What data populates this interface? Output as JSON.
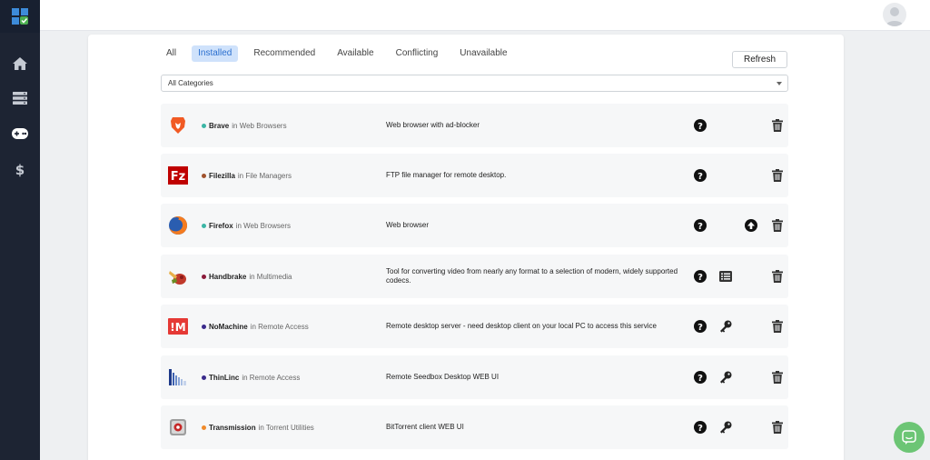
{
  "sidebar": {
    "logo_icon": "app-grid-logo",
    "nav": [
      {
        "name": "home",
        "icon": "home-icon"
      },
      {
        "name": "servers",
        "icon": "server-icon"
      },
      {
        "name": "apps",
        "icon": "gamepad-icon",
        "active": true
      },
      {
        "name": "billing",
        "icon": "dollar-icon"
      }
    ]
  },
  "header": {
    "avatar_icon": "user-avatar-icon"
  },
  "tabs": {
    "all": "All",
    "installed": "Installed",
    "recommended": "Recommended",
    "available": "Available",
    "conflicting": "Conflicting",
    "unavailable": "Unavailable",
    "active": "Installed"
  },
  "toolbar": {
    "refresh_label": "Refresh"
  },
  "filter": {
    "category_value": "All Categories"
  },
  "apps": [
    {
      "name": "Brave",
      "category": "in Web Browsers",
      "description": "Web browser with ad-blocker",
      "dot_color": "#3bb5a5",
      "icon": "brave-logo",
      "actions": [
        "help",
        "delete"
      ]
    },
    {
      "name": "Filezilla",
      "category": "in File Managers",
      "description": "FTP file manager for remote desktop.",
      "dot_color": "#a0522d",
      "icon": "filezilla-logo",
      "actions": [
        "help",
        "delete"
      ]
    },
    {
      "name": "Firefox",
      "category": "in Web Browsers",
      "description": "Web browser",
      "dot_color": "#3bb5a5",
      "icon": "firefox-logo",
      "actions": [
        "help",
        "upgrade",
        "delete"
      ]
    },
    {
      "name": "Handbrake",
      "category": "in Multimedia",
      "description": "Tool for converting video from nearly any format to a selection of modern, widely supported codecs.",
      "dot_color": "#8b1a3a",
      "icon": "handbrake-logo",
      "actions": [
        "help",
        "details",
        "delete"
      ]
    },
    {
      "name": "NoMachine",
      "category": "in Remote Access",
      "description": "Remote desktop server - need desktop client on your local PC to access this service",
      "dot_color": "#3a2a8b",
      "icon": "nomachine-logo",
      "actions": [
        "help",
        "credentials",
        "delete"
      ]
    },
    {
      "name": "ThinLinc",
      "category": "in Remote Access",
      "description": "Remote Seedbox Desktop WEB UI",
      "dot_color": "#3a2a8b",
      "icon": "thinlinc-logo",
      "actions": [
        "help",
        "credentials",
        "delete"
      ]
    },
    {
      "name": "Transmission",
      "category": "in Torrent Utilities",
      "description": "BitTorrent client WEB UI",
      "dot_color": "#f08a2a",
      "icon": "transmission-logo",
      "actions": [
        "help",
        "credentials",
        "delete"
      ]
    }
  ],
  "chat": {
    "icon": "chat-icon"
  }
}
